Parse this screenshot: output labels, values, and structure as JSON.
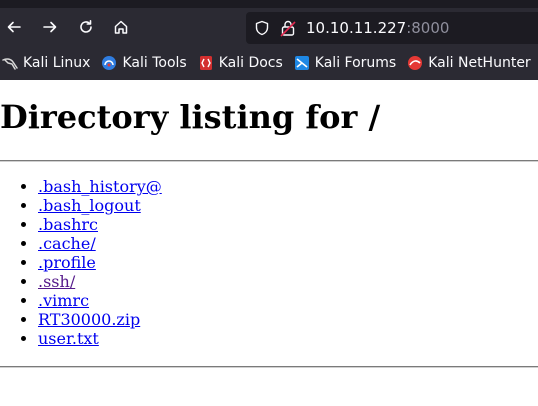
{
  "browser": {
    "url_host": "10.10.11.227",
    "url_port": ":8000",
    "bookmarks": [
      {
        "label": "Kali Linux",
        "icon": "kali-dragon-icon"
      },
      {
        "label": "Kali Tools",
        "icon": "kali-tools-icon"
      },
      {
        "label": "Kali Docs",
        "icon": "kali-docs-icon"
      },
      {
        "label": "Kali Forums",
        "icon": "kali-forums-icon"
      },
      {
        "label": "Kali NetHunter",
        "icon": "kali-nethunter-icon"
      }
    ]
  },
  "page": {
    "title": "Directory listing for /",
    "entries": [
      {
        "name": ".bash_history@",
        "visited": false
      },
      {
        "name": ".bash_logout",
        "visited": false
      },
      {
        "name": ".bashrc",
        "visited": false
      },
      {
        "name": ".cache/",
        "visited": false
      },
      {
        "name": ".profile",
        "visited": false
      },
      {
        "name": ".ssh/",
        "visited": true
      },
      {
        "name": ".vimrc",
        "visited": false
      },
      {
        "name": "RT30000.zip",
        "visited": false
      },
      {
        "name": "user.txt",
        "visited": false
      }
    ]
  }
}
